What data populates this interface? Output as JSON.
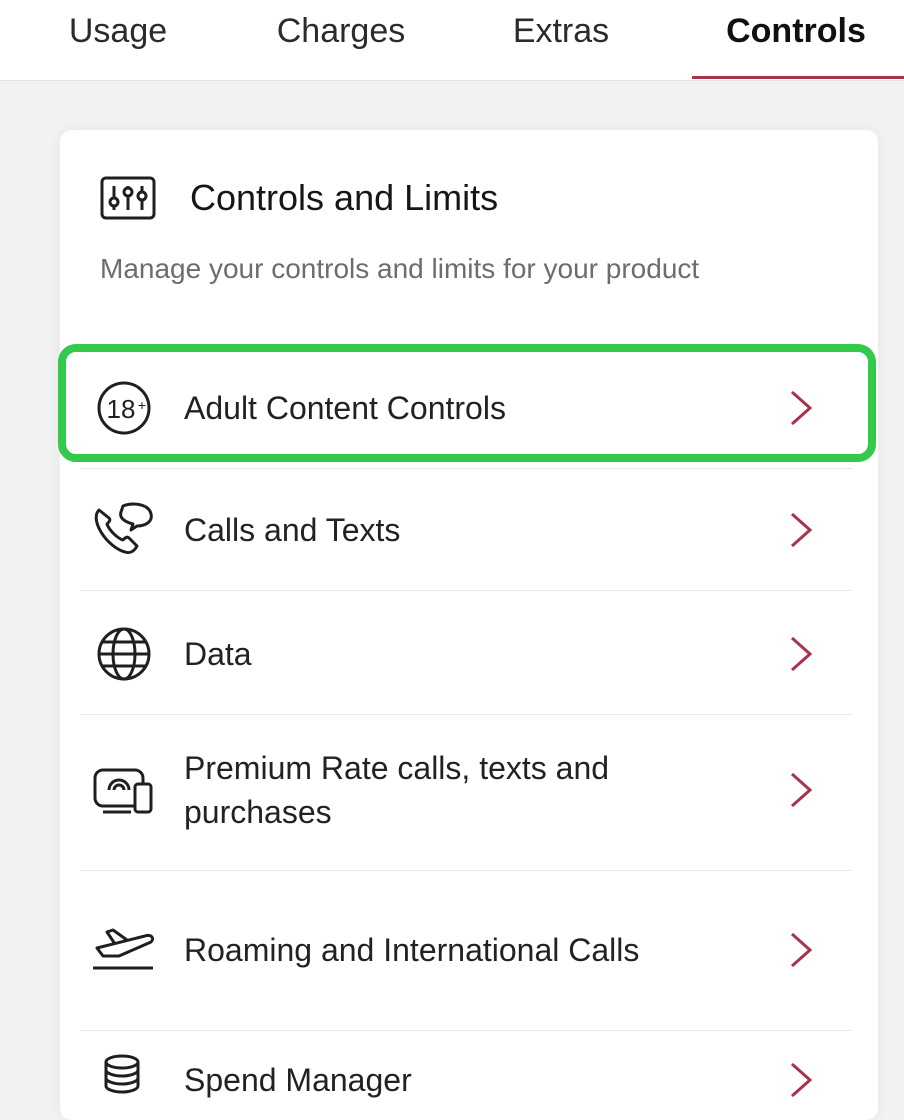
{
  "tabs": [
    {
      "label": "Usage"
    },
    {
      "label": "Charges"
    },
    {
      "label": "Extras"
    },
    {
      "label": "Controls",
      "active": true
    }
  ],
  "card": {
    "title": "Controls and Limits",
    "title_icon": "sliders-icon",
    "subtitle": "Manage your controls and limits for your product"
  },
  "items": [
    {
      "label": "Adult Content Controls",
      "icon": "age-18-plus-icon",
      "highlighted": true
    },
    {
      "label": "Calls and Texts",
      "icon": "phone-chat-icon"
    },
    {
      "label": "Data",
      "icon": "globe-icon"
    },
    {
      "label": "Premium Rate calls, texts and purchases",
      "icon": "premium-device-icon"
    },
    {
      "label": "Roaming and International Calls",
      "icon": "airplane-icon"
    },
    {
      "label": "Spend Manager",
      "icon": "coin-stack-icon"
    }
  ],
  "colors": {
    "accent": "#a8344b",
    "highlight": "#33c94b",
    "chevron": "#a8344b"
  }
}
